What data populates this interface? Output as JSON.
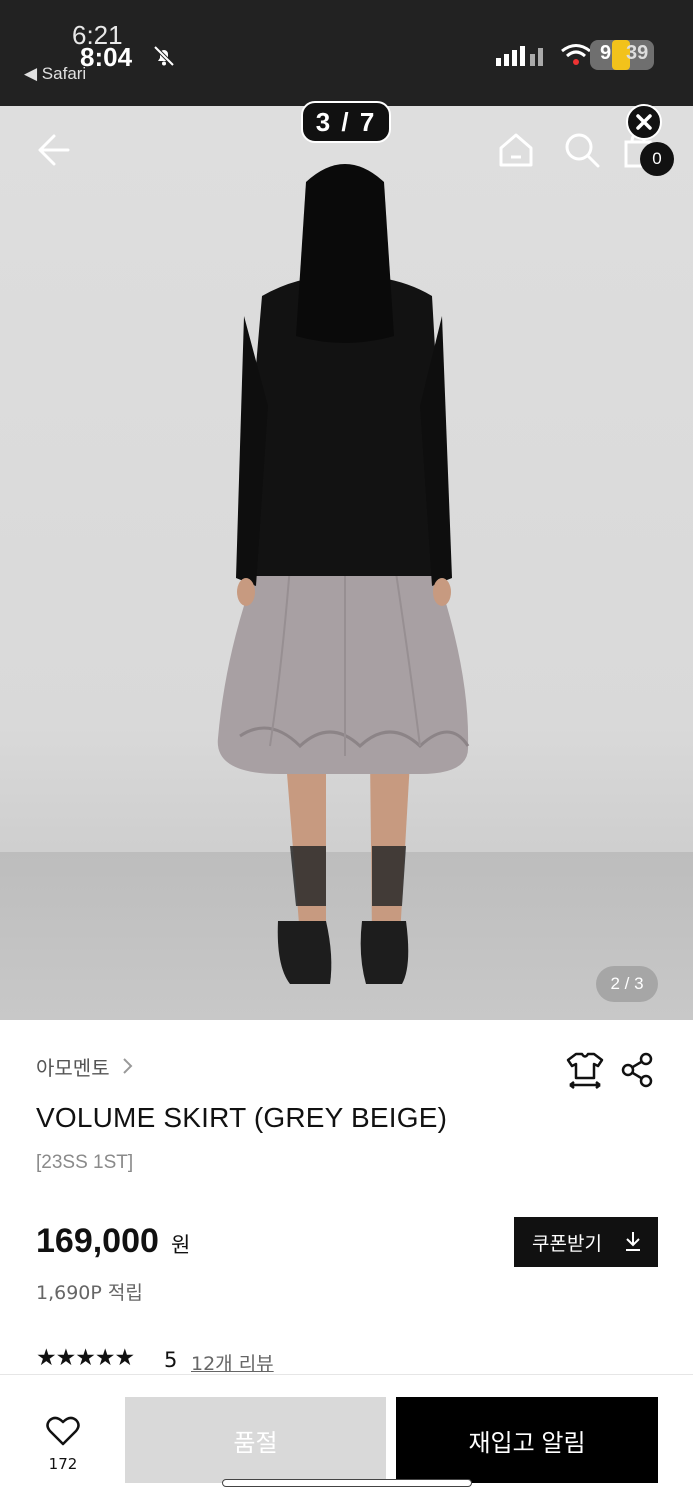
{
  "status_bar": {
    "ghost_time": "6:21",
    "time": "8:04",
    "back_app": "◀ Safari",
    "battery_level": "9",
    "battery_overlay": "39"
  },
  "gallery": {
    "counter": "3 / 7",
    "image_index": "2 / 3",
    "cart_count": "0"
  },
  "product": {
    "brand": "아모멘토",
    "title": "VOLUME SKIRT (GREY BEIGE)",
    "season": "[23SS 1ST]",
    "price": "169,000",
    "currency": "원",
    "points": "1,690P 적립",
    "coupon_label": "쿠폰받기",
    "stars": "★★★★★",
    "rating": "5",
    "review_link": "12개 리뷰"
  },
  "bottom_bar": {
    "like_count": "172",
    "soldout_label": "품절",
    "restock_label": "재입고 알림"
  },
  "colors": {
    "accent": "#111111",
    "status_bar_bg": "#222222",
    "soldout_bg": "#d9d9d9",
    "battery": "#f2c21b"
  },
  "icons": [
    "bell-slash-icon",
    "back-arrow-icon",
    "home-icon",
    "search-icon",
    "cart-icon",
    "close-icon",
    "chevron-right-icon",
    "hanger-icon",
    "share-icon",
    "download-icon",
    "heart-icon"
  ]
}
